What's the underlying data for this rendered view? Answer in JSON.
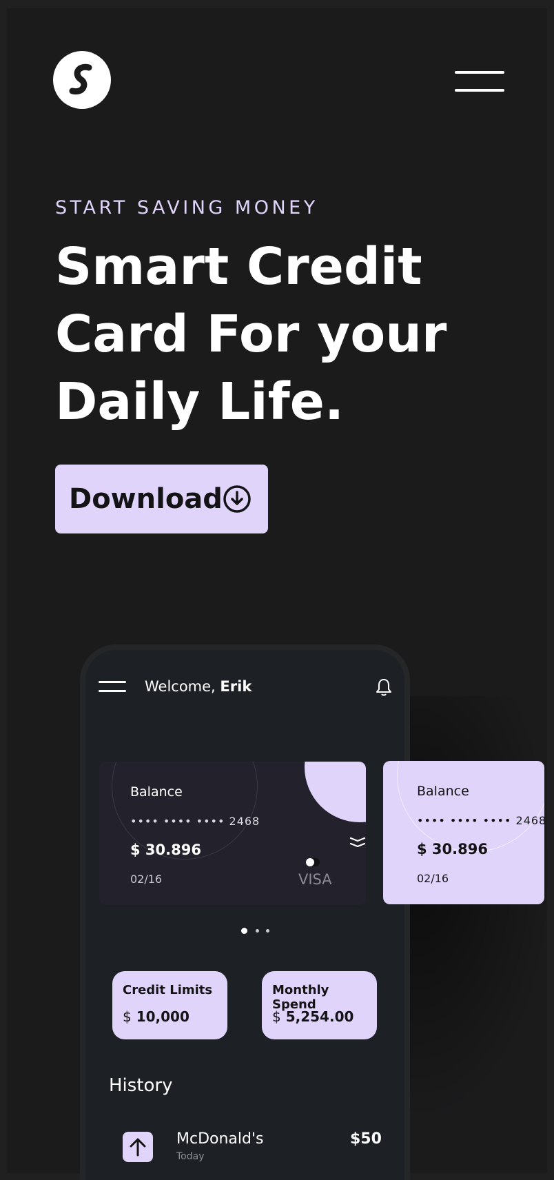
{
  "header": {
    "logo_icon": "brand-s-logo",
    "menu_icon": "hamburger-menu-icon"
  },
  "hero": {
    "eyebrow": "START SAVING MONEY",
    "headline_lines": [
      "Smart Credit",
      "Card For your",
      "Daily Life."
    ],
    "download_label": "Download",
    "download_icon": "download-circle-icon"
  },
  "phone": {
    "welcome_prefix": "Welcome, ",
    "user_name": "Erik",
    "bell_icon": "bell-icon",
    "cards": [
      {
        "label": "Balance",
        "masked_number": "•••• •••• ••••",
        "last4": "2468",
        "amount": "$ 30.896",
        "expiry": "02/16",
        "brand": "VISA"
      },
      {
        "label": "Balance",
        "masked_number": "•••• •••• ••••",
        "last4": "2468",
        "amount": "$ 30.896",
        "expiry": "02/16"
      }
    ],
    "carousel": {
      "total": 3,
      "active": 1
    },
    "tiles": [
      {
        "label": "Credit Limits",
        "currency": "$",
        "value": "10,000"
      },
      {
        "label": "Monthly Spend",
        "currency": "$",
        "value": "5,254.00"
      }
    ],
    "history_title": "History",
    "history": [
      {
        "icon": "arrow-up-icon",
        "name": "McDonald's",
        "date": "Today",
        "amount": "$50"
      }
    ]
  },
  "colors": {
    "background": "#1b1b1c",
    "accent": "#e0d4fb",
    "phone_bg": "#1d2125",
    "card_dark": "#23222c"
  }
}
